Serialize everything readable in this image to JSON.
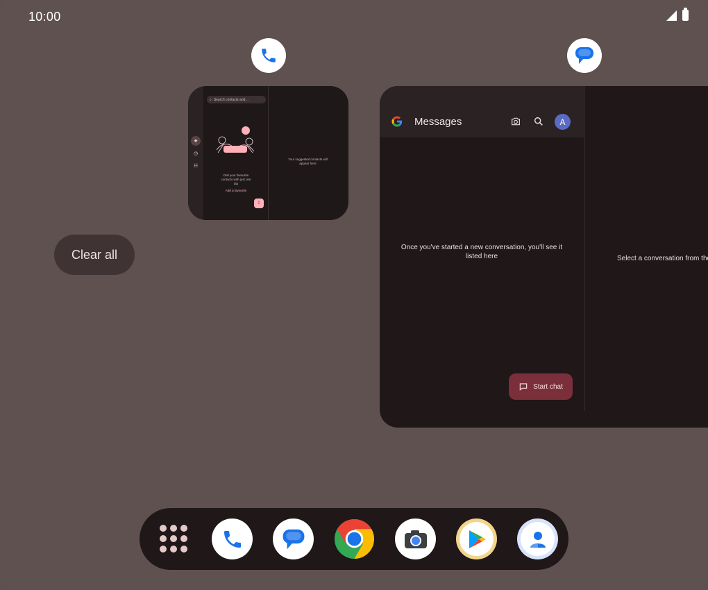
{
  "status_bar": {
    "time": "10:00"
  },
  "clear_all_label": "Clear all",
  "phone_card": {
    "search_placeholder": "Search contacts and…",
    "empty_text": "Dial your favourite contacts with just one tap",
    "add_favourite": "Add a favourite",
    "suggestion_text": "Your suggested contacts will appear here"
  },
  "messages_card": {
    "title": "Messages",
    "avatar_letter": "A",
    "empty_text": "Once you've started a new conversation, you'll see it listed here",
    "select_text": "Select a conversation from the list",
    "start_chat_label": "Start chat"
  },
  "dock": {
    "apps": [
      "App drawer",
      "Phone",
      "Messages",
      "Chrome",
      "Camera",
      "Play Store",
      "Contacts"
    ]
  },
  "colors": {
    "background": "#5f5150",
    "card": "#1f1718",
    "accent_button": "#7b2f3a",
    "avatar": "#5a6bc3"
  }
}
